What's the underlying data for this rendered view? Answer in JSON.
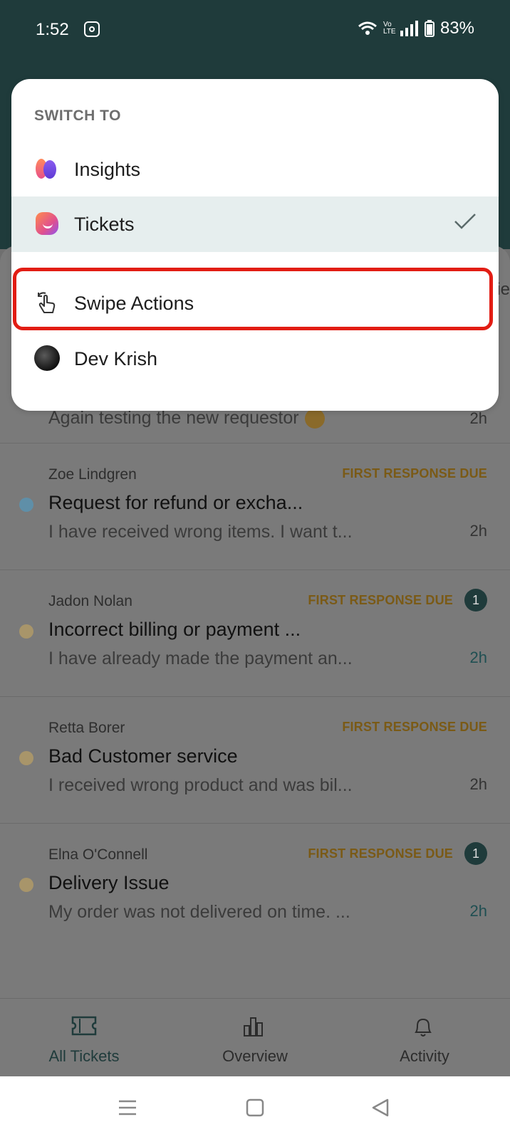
{
  "status_bar": {
    "time": "1:52",
    "battery": "83%",
    "network": "Vo LTE"
  },
  "switch_menu": {
    "heading": "SWITCH TO",
    "items": [
      {
        "label": "Insights",
        "icon": "insights-app-icon"
      },
      {
        "label": "Tickets",
        "icon": "tickets-app-icon",
        "selected": true
      },
      {
        "label": "Swipe Actions",
        "icon": "swipe-gesture-icon",
        "highlighted": true
      },
      {
        "label": "Dev Krish",
        "icon": "user-avatar"
      }
    ]
  },
  "tickets": {
    "partial_top": {
      "snippet": "Again testing the new requestor",
      "age": "2h"
    },
    "rows": [
      {
        "requester": "Zoe Lindgren",
        "status": "FIRST RESPONSE DUE",
        "subject": "Request for refund or excha...",
        "snippet": "I have received wrong items. I want t...",
        "age": "2h",
        "dot_color": "#5f8fa8"
      },
      {
        "requester": "Jadon Nolan",
        "status": "FIRST RESPONSE DUE",
        "badge": "1",
        "subject": "Incorrect billing or payment ...",
        "snippet": "I have already made the payment an...",
        "age": "2h",
        "dot_color": "#a8956a"
      },
      {
        "requester": "Retta Borer",
        "status": "FIRST RESPONSE DUE",
        "subject": "Bad Customer service",
        "snippet": "I received wrong product and was bil...",
        "age": "2h",
        "dot_color": "#a8956a"
      },
      {
        "requester": "Elna O'Connell",
        "status": "FIRST RESPONSE DUE",
        "badge": "1",
        "subject": "Delivery Issue",
        "snippet": "My order was not delivered on time. ...",
        "age": "2h",
        "dot_color": "#a8956a"
      }
    ]
  },
  "bottom_nav": {
    "items": [
      {
        "label": "All Tickets",
        "icon": "ticket-icon",
        "active": true
      },
      {
        "label": "Overview",
        "icon": "bar-chart-icon"
      },
      {
        "label": "Activity",
        "icon": "bell-icon"
      }
    ]
  },
  "colors": {
    "header": "#1f3b3b",
    "highlight_border": "#e21d14",
    "selected_bg": "#e6eeee",
    "status_due": "#7a5a16"
  }
}
